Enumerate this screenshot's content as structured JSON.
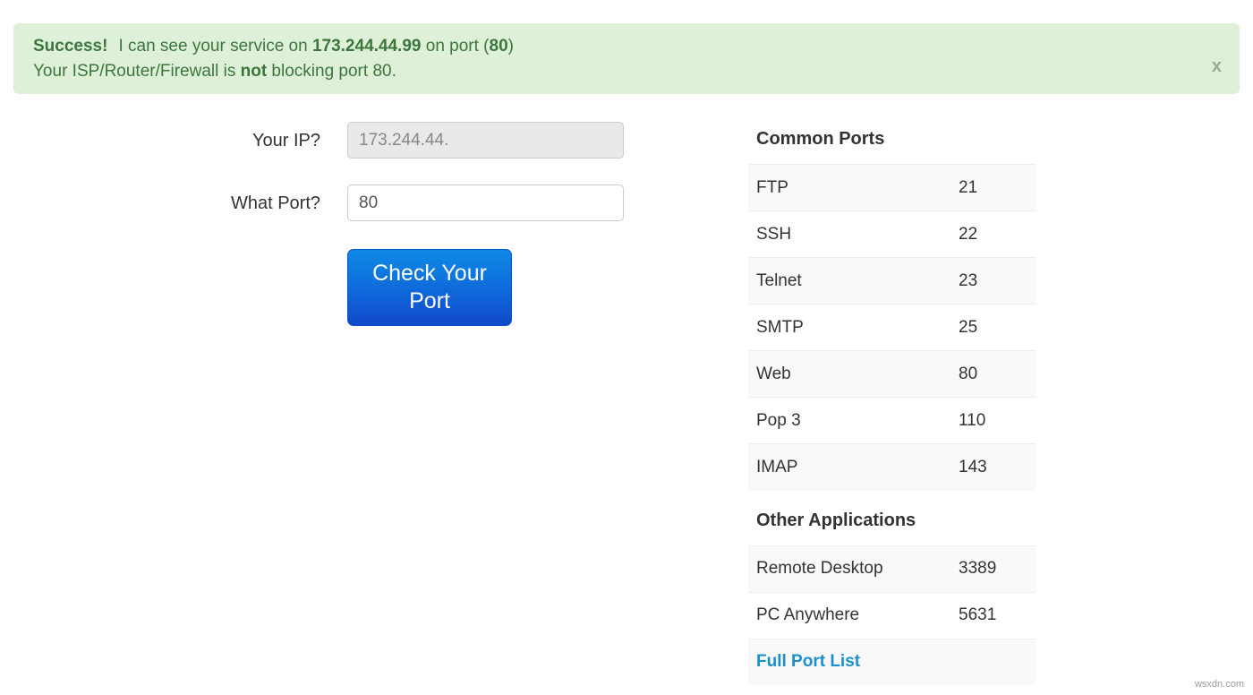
{
  "alert": {
    "status_label": "Success!",
    "line1_prefix": "I can see your service on ",
    "line1_ip": "173.244.44.99",
    "line1_mid": " on port (",
    "line1_port": "80",
    "line1_suffix": ")",
    "line2_prefix": "Your ISP/Router/Firewall is ",
    "line2_not": "not",
    "line2_suffix": " blocking port 80.",
    "close_label": "x",
    "background_color": "#dff0d8",
    "text_color": "#3c763d"
  },
  "form": {
    "ip_label": "Your IP?",
    "ip_value": "173.244.44.",
    "ip_placeholder": "Your IP",
    "port_label": "What Port?",
    "port_value": "80",
    "port_placeholder": "Port",
    "submit_label": "Check Your Port",
    "button_color": "#0f6fdc"
  },
  "ports_panel": {
    "common_heading": "Common Ports",
    "other_heading": "Other Applications",
    "common_ports": [
      {
        "name": "FTP",
        "port": "21"
      },
      {
        "name": "SSH",
        "port": "22"
      },
      {
        "name": "Telnet",
        "port": "23"
      },
      {
        "name": "SMTP",
        "port": "25"
      },
      {
        "name": "Web",
        "port": "80"
      },
      {
        "name": "Pop 3",
        "port": "110"
      },
      {
        "name": "IMAP",
        "port": "143"
      }
    ],
    "other_applications": [
      {
        "name": "Remote Desktop",
        "port": "3389"
      },
      {
        "name": "PC Anywhere",
        "port": "5631"
      }
    ],
    "full_list_link": "Full Port List",
    "link_color": "#1b8fcc"
  },
  "watermark": "wsxdn.com"
}
